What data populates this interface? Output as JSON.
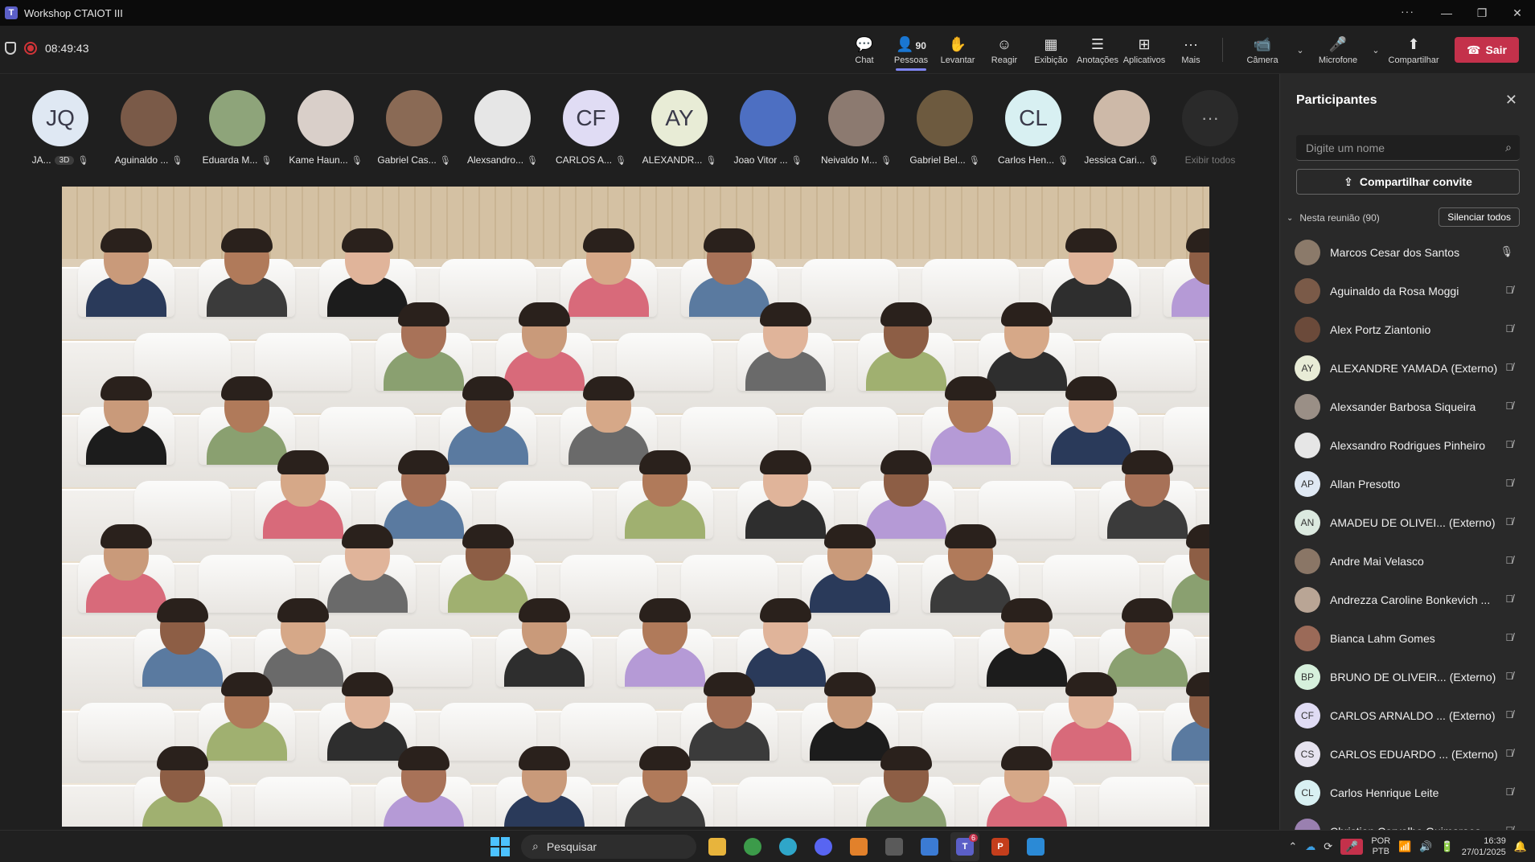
{
  "window": {
    "title": "Workshop CTAIOT III"
  },
  "meeting": {
    "timer": "08:49:43"
  },
  "toolbar": {
    "items": [
      {
        "label": "Chat",
        "icon": "chat-icon"
      },
      {
        "label": "Pessoas",
        "icon": "people-icon",
        "count": "90"
      },
      {
        "label": "Levantar",
        "icon": "raise-hand-icon"
      },
      {
        "label": "Reagir",
        "icon": "react-icon"
      },
      {
        "label": "Exibição",
        "icon": "view-icon"
      },
      {
        "label": "Anotações",
        "icon": "notes-icon"
      },
      {
        "label": "Aplicativos",
        "icon": "apps-icon"
      },
      {
        "label": "Mais",
        "icon": "more-icon"
      }
    ],
    "camera_label": "Câmera",
    "mic_label": "Microfone",
    "share_label": "Compartilhar",
    "leave_label": "Sair"
  },
  "strip": [
    {
      "initials": "JQ",
      "name": "JA...",
      "tag": "3D",
      "color": "#dfe8f3"
    },
    {
      "initials": "",
      "name": "Aguinaldo ...",
      "color": "#7a5a48"
    },
    {
      "initials": "",
      "name": "Eduarda M...",
      "color": "#8ea47a"
    },
    {
      "initials": "",
      "name": "Kame Haun...",
      "color": "#d9cfc9"
    },
    {
      "initials": "",
      "name": "Gabriel Cas...",
      "color": "#8a6a55"
    },
    {
      "initials": "",
      "name": "Alexsandro...",
      "color": "#e6e6e6"
    },
    {
      "initials": "CF",
      "name": "CARLOS A...",
      "color": "#e0dcf4"
    },
    {
      "initials": "AY",
      "name": "ALEXANDR...",
      "color": "#e8ecd6"
    },
    {
      "initials": "",
      "name": "Joao Vitor ...",
      "color": "#4d6fc2"
    },
    {
      "initials": "",
      "name": "Neivaldo M...",
      "color": "#8c7a70"
    },
    {
      "initials": "",
      "name": "Gabriel Bel...",
      "color": "#6d5a3f"
    },
    {
      "initials": "CL",
      "name": "Carlos Hen...",
      "color": "#d8f0f2"
    },
    {
      "initials": "",
      "name": "Jessica Cari...",
      "color": "#cdb9a8"
    }
  ],
  "strip_more": {
    "label": "Exibir todos"
  },
  "panel": {
    "title": "Participantes",
    "search_placeholder": "Digite um nome",
    "share_invite": "Compartilhar convite",
    "section": "Nesta reunião (90)",
    "mute_all": "Silenciar todos",
    "participants": [
      {
        "initials": "",
        "name": "Marcos Cesar dos Santos",
        "ext": "",
        "color": "#8b7a6a",
        "mic": "on"
      },
      {
        "initials": "",
        "name": "Aguinaldo da Rosa Moggi",
        "ext": "",
        "color": "#7a5a48",
        "mic": "off"
      },
      {
        "initials": "",
        "name": "Alex Portz Ziantonio",
        "ext": "",
        "color": "#6b4a3a",
        "mic": "off"
      },
      {
        "initials": "AY",
        "name": "ALEXANDRE YAMADA",
        "ext": "(Externo)",
        "color": "#e8ecd6",
        "mic": "off"
      },
      {
        "initials": "",
        "name": "Alexsander Barbosa Siqueira",
        "ext": "",
        "color": "#9a8f86",
        "mic": "off"
      },
      {
        "initials": "",
        "name": "Alexsandro Rodrigues Pinheiro",
        "ext": "",
        "color": "#e6e6e6",
        "mic": "off"
      },
      {
        "initials": "AP",
        "name": "Allan Presotto",
        "ext": "",
        "color": "#dfe8f3",
        "mic": "off"
      },
      {
        "initials": "AN",
        "name": "AMADEU DE OLIVEI...",
        "ext": "(Externo)",
        "color": "#dbe9df",
        "mic": "off"
      },
      {
        "initials": "",
        "name": "Andre Mai Velasco",
        "ext": "",
        "color": "#8a7666",
        "mic": "off"
      },
      {
        "initials": "",
        "name": "Andrezza Caroline Bonkevich ...",
        "ext": "",
        "color": "#b9a595",
        "mic": "off"
      },
      {
        "initials": "",
        "name": "Bianca Lahm Gomes",
        "ext": "",
        "color": "#9b6a58",
        "mic": "off"
      },
      {
        "initials": "BP",
        "name": "BRUNO DE OLIVEIR...",
        "ext": "(Externo)",
        "color": "#d6f0dc",
        "mic": "off"
      },
      {
        "initials": "CF",
        "name": "CARLOS ARNALDO ...",
        "ext": "(Externo)",
        "color": "#e0dcf4",
        "mic": "off"
      },
      {
        "initials": "CS",
        "name": "CARLOS EDUARDO ...",
        "ext": "(Externo)",
        "color": "#e6e3ef",
        "mic": "off"
      },
      {
        "initials": "CL",
        "name": "Carlos Henrique Leite",
        "ext": "",
        "color": "#d8f0f2",
        "mic": "off"
      },
      {
        "initials": "",
        "name": "Christian Carvalho Guimaraes",
        "ext": "",
        "color": "#9a80b0",
        "mic": "off"
      }
    ]
  },
  "taskbar": {
    "search_label": "Pesquisar",
    "teams_badge": "6",
    "lang_top": "POR",
    "lang_bottom": "PTB",
    "time": "16:39",
    "date": "27/01/2025"
  }
}
